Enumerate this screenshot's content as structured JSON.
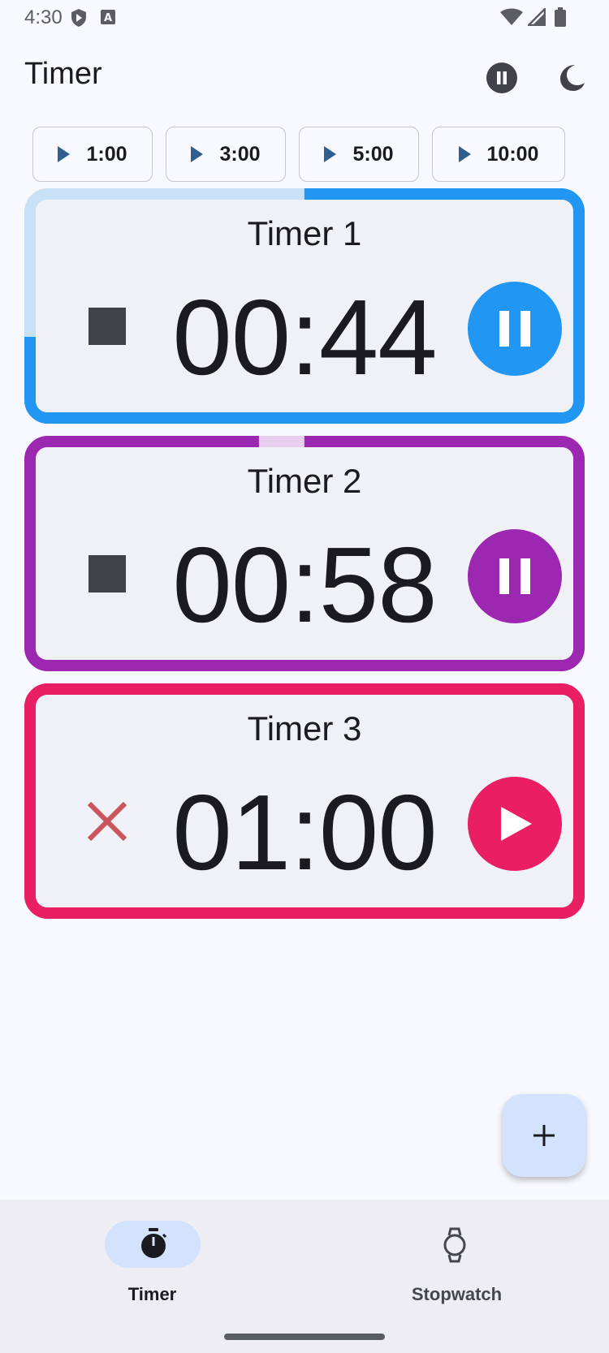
{
  "status_bar": {
    "time": "4:30",
    "icons": [
      "shield-play-icon",
      "a-box-icon",
      "wifi-icon",
      "signal-icon",
      "battery-icon"
    ]
  },
  "app_bar": {
    "title": "Timer",
    "actions": [
      "pause-all-icon",
      "dark-mode-icon"
    ]
  },
  "presets": [
    {
      "label": "1:00"
    },
    {
      "label": "3:00"
    },
    {
      "label": "5:00"
    },
    {
      "label": "10:00"
    }
  ],
  "timers": [
    {
      "title": "Timer 1",
      "time": "00:44",
      "state": "running",
      "color": "#2196f3",
      "track_color": "#c9e1f7",
      "progress_remaining": 0.73
    },
    {
      "title": "Timer 2",
      "time": "00:58",
      "state": "running",
      "color": "#9c27b0",
      "track_color": "#e7cdee",
      "progress_remaining": 0.97
    },
    {
      "title": "Timer 3",
      "time": "01:00",
      "state": "stopped",
      "color": "#e91e63",
      "track_color": "#e91e63",
      "progress_remaining": 1.0
    }
  ],
  "fab": {
    "icon": "plus-icon"
  },
  "bottom_nav": {
    "items": [
      {
        "label": "Timer",
        "icon": "timer-icon",
        "active": true
      },
      {
        "label": "Stopwatch",
        "icon": "stopwatch-icon",
        "active": false
      }
    ]
  },
  "colors": {
    "background": "#f8f9ff",
    "accent": "#d3e3fd",
    "cancel": "#c9545c"
  }
}
